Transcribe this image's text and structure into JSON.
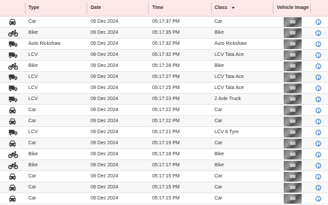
{
  "headers": {
    "type": "Type",
    "date": "Date",
    "time": "Time",
    "class": "Class",
    "vehicle_image": "Vehicle Image"
  },
  "rows": [
    {
      "icon": "car-icon",
      "type": "Car",
      "date": "09 Dec 2024",
      "time": "05:17:37 PM",
      "class": "Car"
    },
    {
      "icon": "bike-icon",
      "type": "Bike",
      "date": "09 Dec 2024",
      "time": "05:17:35 PM",
      "class": "Bike"
    },
    {
      "icon": "truck-icon",
      "type": "Auto Rickshaw",
      "date": "09 Dec 2024",
      "time": "05:17:32 PM",
      "class": "Auto Rickshaw"
    },
    {
      "icon": "truck-icon",
      "type": "LCV",
      "date": "09 Dec 2024",
      "time": "05:17:32 PM",
      "class": "LCV Tata Ace"
    },
    {
      "icon": "bike-icon",
      "type": "Bike",
      "date": "09 Dec 2024",
      "time": "05:17:28 PM",
      "class": "Bike"
    },
    {
      "icon": "truck-icon",
      "type": "LCV",
      "date": "09 Dec 2024",
      "time": "05:17:27 PM",
      "class": "LCV Tata Ace"
    },
    {
      "icon": "truck-icon",
      "type": "LCV",
      "date": "09 Dec 2024",
      "time": "05:17:25 PM",
      "class": "LCV Tata Ace"
    },
    {
      "icon": "truck-icon",
      "type": "LCV",
      "date": "09 Dec 2024",
      "time": "05:17:23 PM",
      "class": "2 Axle Truck"
    },
    {
      "icon": "car-icon",
      "type": "Car",
      "date": "09 Dec 2024",
      "time": "05:17:22 PM",
      "class": "Car"
    },
    {
      "icon": "car-icon",
      "type": "Car",
      "date": "09 Dec 2024",
      "time": "05:17:22 PM",
      "class": "Car"
    },
    {
      "icon": "truck-icon",
      "type": "LCV",
      "date": "09 Dec 2024",
      "time": "05:17:21 PM",
      "class": "LCV 6 Tyre"
    },
    {
      "icon": "car-icon",
      "type": "Car",
      "date": "09 Dec 2024",
      "time": "05:17:19 PM",
      "class": "Car"
    },
    {
      "icon": "bike-icon",
      "type": "Bike",
      "date": "09 Dec 2024",
      "time": "05:17:18 PM",
      "class": "Bike"
    },
    {
      "icon": "bike-icon",
      "type": "Bike",
      "date": "09 Dec 2024",
      "time": "05:17:17 PM",
      "class": "Bike"
    },
    {
      "icon": "car-icon",
      "type": "Car",
      "date": "09 Dec 2024",
      "time": "05:17:15 PM",
      "class": "Car"
    },
    {
      "icon": "car-icon",
      "type": "Car",
      "date": "09 Dec 2024",
      "time": "05:17:15 PM",
      "class": "Car"
    },
    {
      "icon": "car-icon",
      "type": "Car",
      "date": "09 Dec 2024",
      "time": "05:17:15 PM",
      "class": "Car"
    }
  ]
}
